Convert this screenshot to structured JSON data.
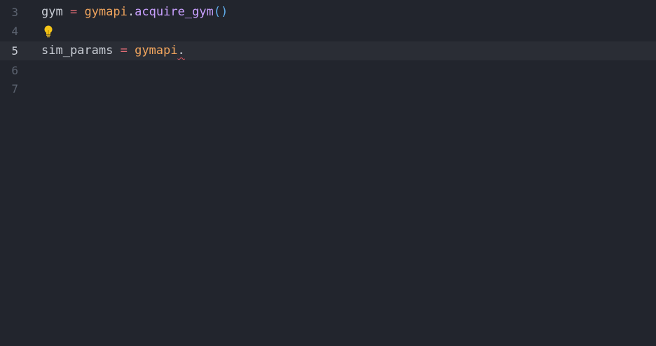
{
  "editor": {
    "lines": [
      {
        "number": "3",
        "tokens": {
          "var": "gym",
          "op": " = ",
          "module": "gymapi",
          "dot": ".",
          "func": "acquire_gym",
          "parens": "()"
        }
      },
      {
        "number": "4",
        "lightbulb_icon": "lightbulb-icon"
      },
      {
        "number": "5",
        "active": true,
        "tokens": {
          "var": "sim_params",
          "op": " = ",
          "module": "gymapi",
          "dot": "."
        },
        "error_squiggle": true
      },
      {
        "number": "6"
      },
      {
        "number": "7"
      }
    ]
  },
  "colors": {
    "background": "#22252d",
    "active_line": "#2a2d35",
    "line_number": "#5c6370",
    "operator": "#e06c75",
    "module": "#f0a45d",
    "function": "#c9a0ff",
    "paren": "#61afef",
    "error": "#e05561",
    "lightbulb": "#f5c518"
  }
}
